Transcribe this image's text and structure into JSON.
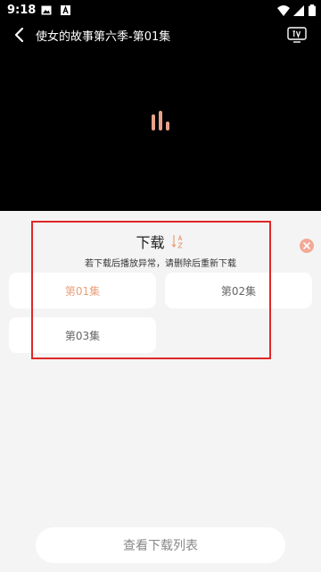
{
  "status_bar": {
    "time": "9:18",
    "icons": [
      "image-icon",
      "a-icon",
      "wifi-icon",
      "signal-icon",
      "battery-icon"
    ]
  },
  "video_header": {
    "title": "使女的故事第六季-第01集",
    "back_icon": "back-icon",
    "cast_icon": "tv-cast-icon"
  },
  "loading": {
    "color": "#e6a387"
  },
  "download_panel": {
    "title": "下载",
    "sort_icon": "sort-az-icon",
    "subtitle": "若下载后播放异常，请删除后重新下载",
    "close_icon": "close-icon",
    "episodes": [
      {
        "label": "第01集",
        "active": true
      },
      {
        "label": "第02集",
        "active": false
      },
      {
        "label": "第03集",
        "active": false
      }
    ],
    "active_color": "#e8a07d",
    "highlight_color": "#e02727"
  },
  "footer": {
    "view_downloads_label": "查看下载列表"
  }
}
